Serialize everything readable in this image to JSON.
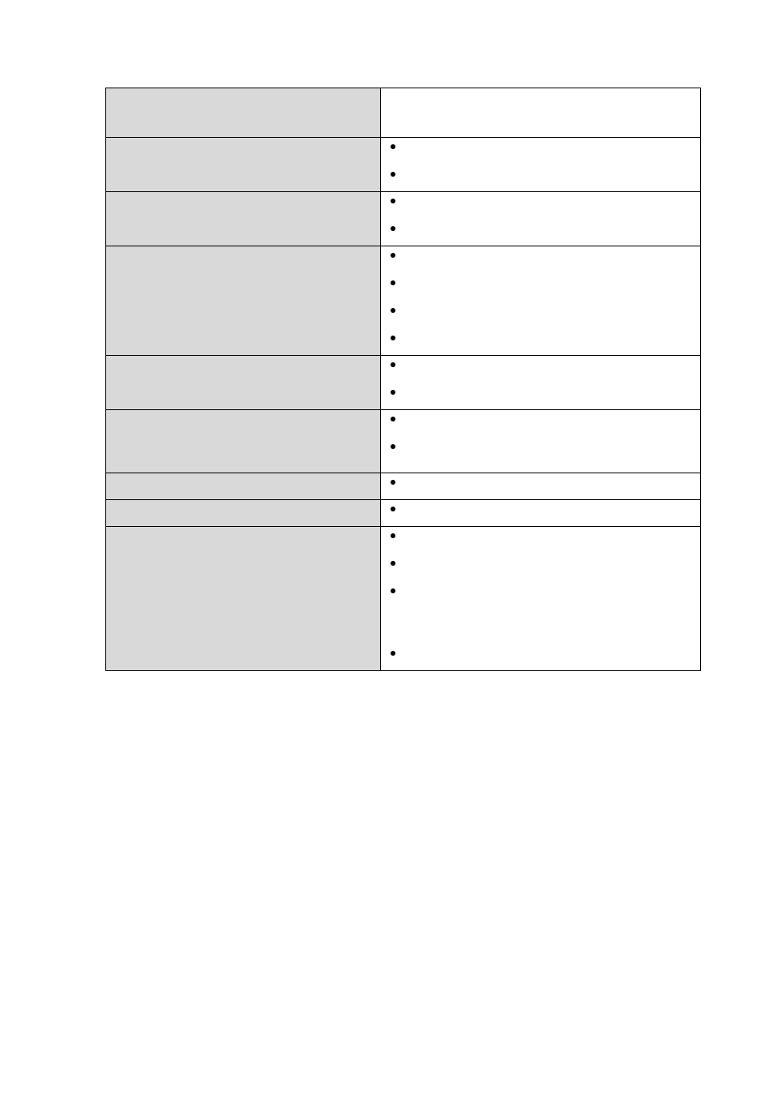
{
  "rows": [
    {
      "left": "",
      "bullets": []
    },
    {
      "left": "",
      "bullets": [
        "",
        ""
      ]
    },
    {
      "left": "",
      "bullets": [
        "",
        ""
      ]
    },
    {
      "left": "",
      "bullets": [
        "",
        "",
        "",
        ""
      ]
    },
    {
      "left": "",
      "bullets": [
        "",
        ""
      ]
    },
    {
      "left": "",
      "bullets": [
        "",
        "\n\n"
      ]
    },
    {
      "left": "",
      "bullets": [
        ""
      ]
    },
    {
      "left": "",
      "bullets": [
        ""
      ]
    },
    {
      "left": "",
      "bullets": [
        "",
        "",
        "\n\n\n\n",
        ""
      ]
    }
  ]
}
